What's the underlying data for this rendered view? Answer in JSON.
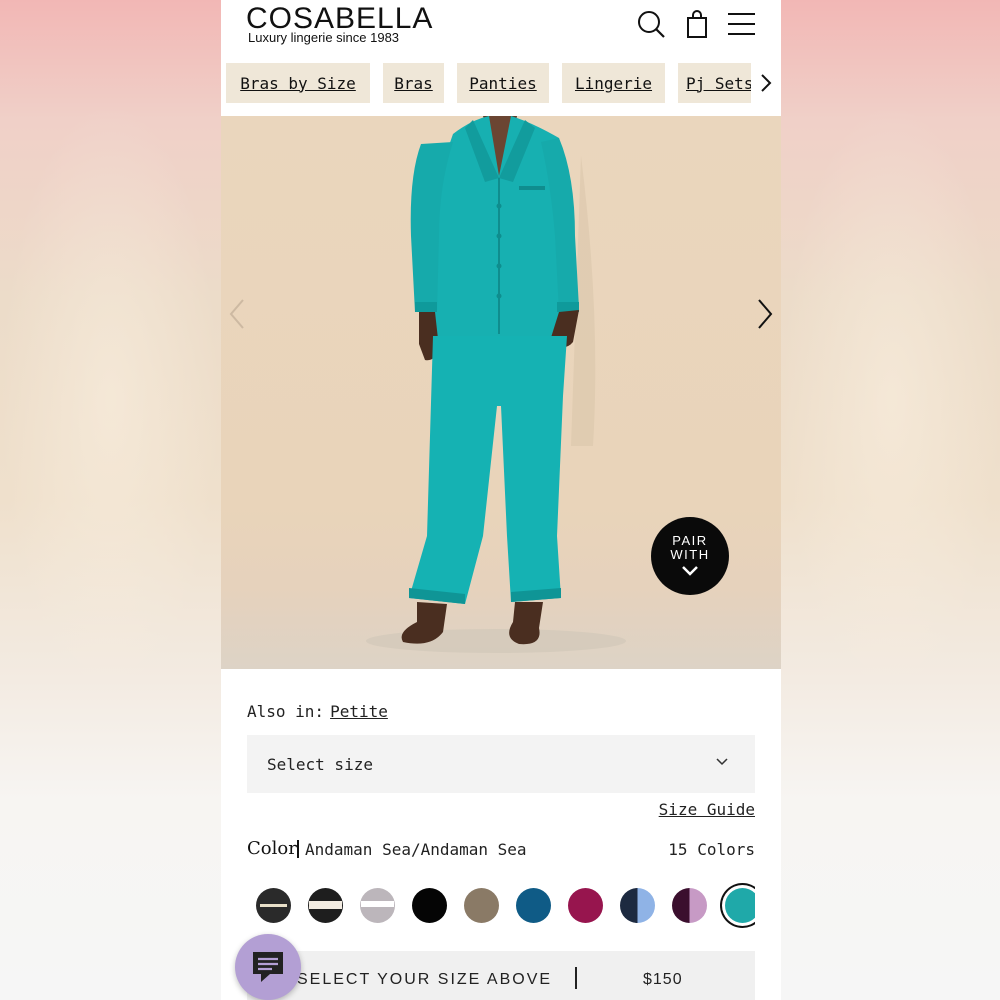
{
  "header": {
    "logo": "COSABELLA",
    "tagline": "Luxury lingerie since 1983",
    "icons": [
      "search-icon",
      "bag-icon",
      "menu-icon"
    ]
  },
  "categories": {
    "items": [
      {
        "label": "Bras by Size"
      },
      {
        "label": "Bras"
      },
      {
        "label": "Panties"
      },
      {
        "label": "Lingerie"
      },
      {
        "label": "Pj Sets"
      }
    ]
  },
  "hero": {
    "pair_with_line1": "PAIR",
    "pair_with_line2": "WITH"
  },
  "product": {
    "also_in_label": "Also in:",
    "also_in_link": "Petite",
    "size_placeholder": "Select size",
    "size_guide": "Size Guide",
    "color_label": "Color",
    "color_value": "Andaman Sea/Andaman Sea",
    "color_count": "15 Colors",
    "swatches": [
      {
        "name": "black-stripe",
        "color": "#2a2a2a"
      },
      {
        "name": "black-white",
        "color": "#1e1e1e"
      },
      {
        "name": "grey-white",
        "color": "#bcb6bb"
      },
      {
        "name": "black",
        "color": "#050505"
      },
      {
        "name": "taupe",
        "color": "#8a7a66"
      },
      {
        "name": "blue",
        "color": "#0f5b86"
      },
      {
        "name": "magenta",
        "color": "#97154e"
      },
      {
        "name": "navy-lightblue",
        "color": "#1d2a40"
      },
      {
        "name": "plum-mauve",
        "color": "#3b0f2e"
      },
      {
        "name": "andaman-sea",
        "color": "#1fa9a9"
      }
    ],
    "selected_swatch_index": 9
  },
  "buybar": {
    "label": "SELECT YOUR SIZE ABOVE",
    "price": "$150"
  },
  "colors": {
    "accent_tan": "#efe7d8",
    "teal": "#1fb1b2",
    "chat_purple": "#b39fd4"
  }
}
